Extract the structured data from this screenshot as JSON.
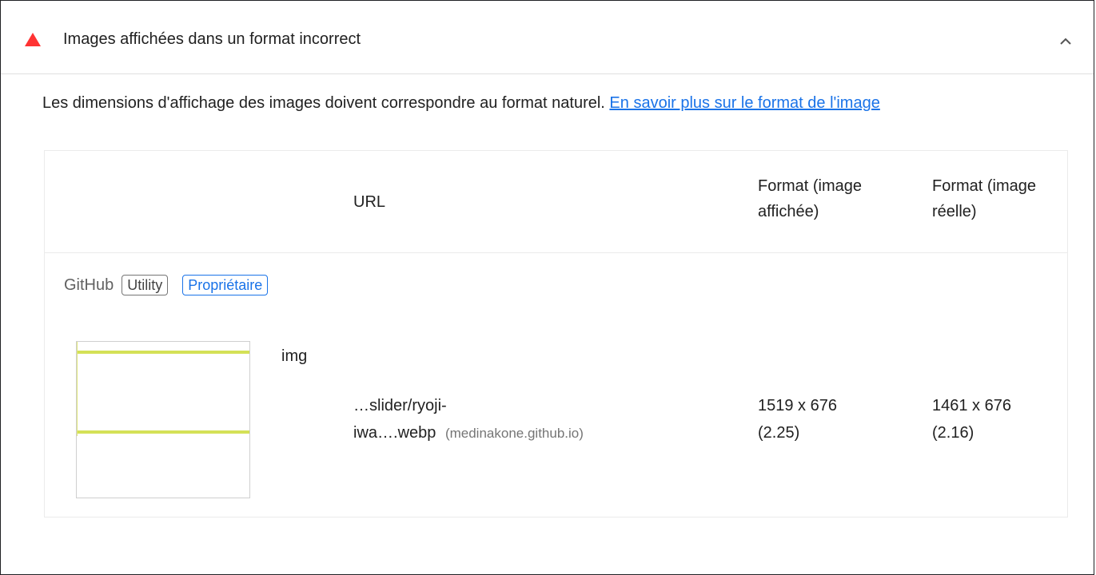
{
  "audit": {
    "title": "Images affichées dans un format incorrect",
    "description": "Les dimensions d'affichage des images doivent correspondre au format naturel.",
    "learn_more": "En savoir plus sur le format de l'image",
    "warning_color": "#ff3333",
    "link_color": "#1a73e8",
    "icons": {
      "status": "warning-triangle-icon",
      "toggle": "chevron-up-icon"
    }
  },
  "table": {
    "headers": {
      "url": "URL",
      "displayed_line1": "Format (image",
      "displayed_line2": "affichée)",
      "actual_line1": "Format (image",
      "actual_line2": "réelle)"
    },
    "entity": {
      "name": "GitHub",
      "chip_utility": "Utility",
      "chip_owner": "Propriétaire"
    },
    "rows": [
      {
        "node": "img",
        "url_line1": "…slider/ryoji-",
        "url_line2": "iwa….webp",
        "origin": "(medinakone.github.io)",
        "displayed_line1": "1519 x 676",
        "displayed_line2": "(2.25)",
        "actual_line1": "1461 x 676",
        "actual_line2": "(2.16)"
      }
    ]
  }
}
